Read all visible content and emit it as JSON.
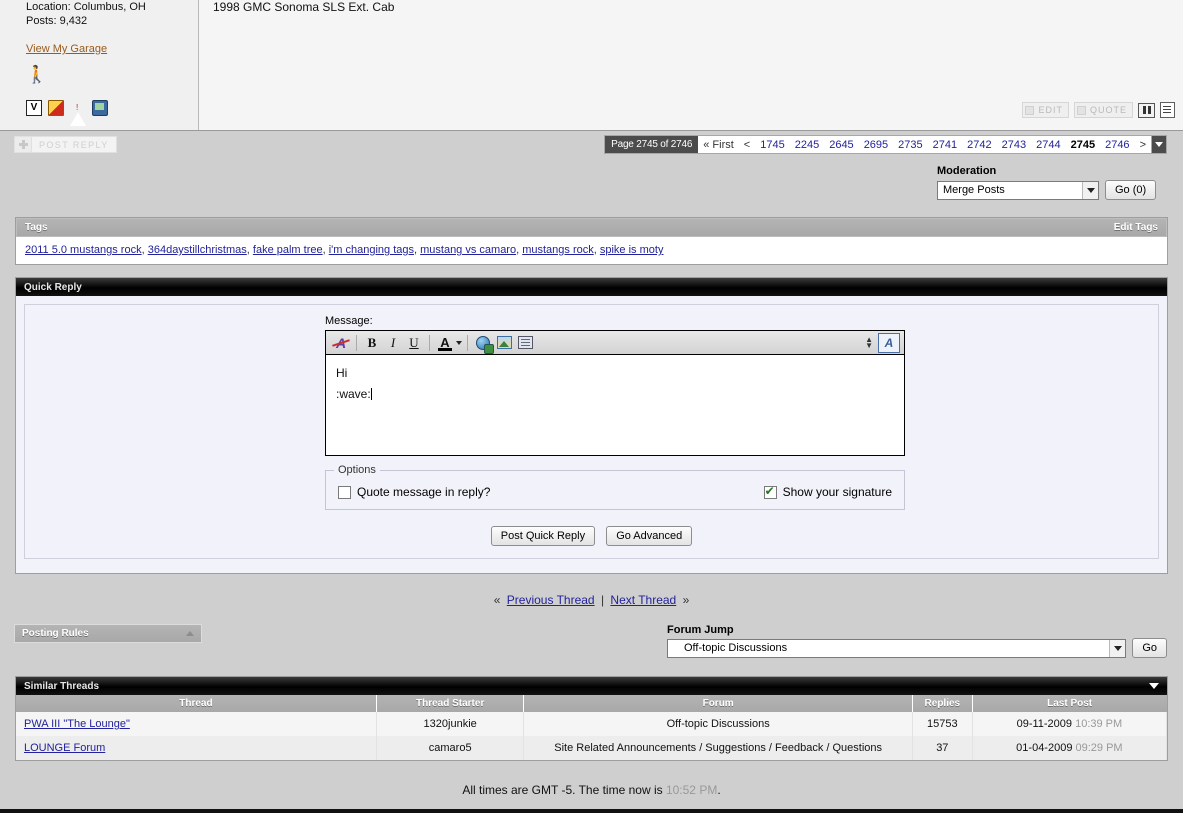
{
  "post": {
    "location": "Location: Columbus, OH",
    "posts_count": "Posts: 9,432",
    "garage_link": "View My Garage",
    "signature": "1998 GMC Sonoma SLS Ext. Cab",
    "controls": {
      "edit": "EDIT",
      "quote": "QUOTE"
    }
  },
  "toolbar": {
    "post_reply": "POST REPLY"
  },
  "pagination": {
    "label": "Page 2745 of 2746",
    "first": "« First",
    "prev": "<",
    "pages": [
      "1745",
      "2245",
      "2645",
      "2695",
      "2735",
      "2741",
      "2742",
      "2743",
      "2744",
      "2745",
      "2746"
    ],
    "current": "2745",
    "next": ">"
  },
  "moderation": {
    "title": "Moderation",
    "selected": "Merge Posts",
    "go_label": "Go (0)"
  },
  "tags": {
    "title": "Tags",
    "edit_link": "Edit Tags",
    "items": [
      "2011 5.0 mustangs rock",
      "364daystillchristmas",
      "fake palm tree",
      "i'm changing tags",
      "mustang vs camaro",
      "mustangs rock",
      "spike is moty"
    ]
  },
  "quick_reply": {
    "title": "Quick Reply",
    "message_label": "Message:",
    "message_lines": [
      "Hi",
      ":wave:"
    ],
    "options_legend": "Options",
    "quote_option": "Quote message in reply?",
    "quote_checked": false,
    "signature_option": "Show your signature",
    "signature_checked": true,
    "post_button": "Post Quick Reply",
    "advanced_button": "Go Advanced",
    "editor_icons": [
      "remove-formatting-icon",
      "bold-icon",
      "italic-icon",
      "underline-icon",
      "font-color-icon",
      "insert-link-icon",
      "insert-image-icon",
      "wrap-tags-icon"
    ]
  },
  "thread_nav": {
    "prev": "Previous Thread",
    "next": "Next Thread",
    "sep": "|",
    "left_chevron": "«",
    "right_chevron": "»"
  },
  "posting_rules": {
    "title": "Posting Rules"
  },
  "forum_jump": {
    "title": "Forum Jump",
    "selected": "Off-topic Discussions",
    "go_label": "Go"
  },
  "similar_threads": {
    "title": "Similar Threads",
    "columns": [
      "Thread",
      "Thread Starter",
      "Forum",
      "Replies",
      "Last Post"
    ],
    "rows": [
      {
        "thread": "PWA III \"The Lounge\"",
        "starter": "1320junkie",
        "forum": "Off-topic Discussions",
        "replies": "15753",
        "last_post_date": "09-11-2009",
        "last_post_time": "10:39 PM"
      },
      {
        "thread": "LOUNGE Forum",
        "starter": "camaro5",
        "forum": "Site Related Announcements / Suggestions / Feedback / Questions",
        "replies": "37",
        "last_post_date": "01-04-2009",
        "last_post_time": "09:29 PM"
      }
    ]
  },
  "footer": {
    "text_before": "All times are GMT -5. The time now is",
    "time": "10:52 PM",
    "text_after": "."
  },
  "colors": {
    "link": "#22229C",
    "garage_link": "#9a5b1e",
    "page_bg": "#cfcfcf",
    "bar_grey": "#aeaeae",
    "bar_dark": "#000000"
  }
}
